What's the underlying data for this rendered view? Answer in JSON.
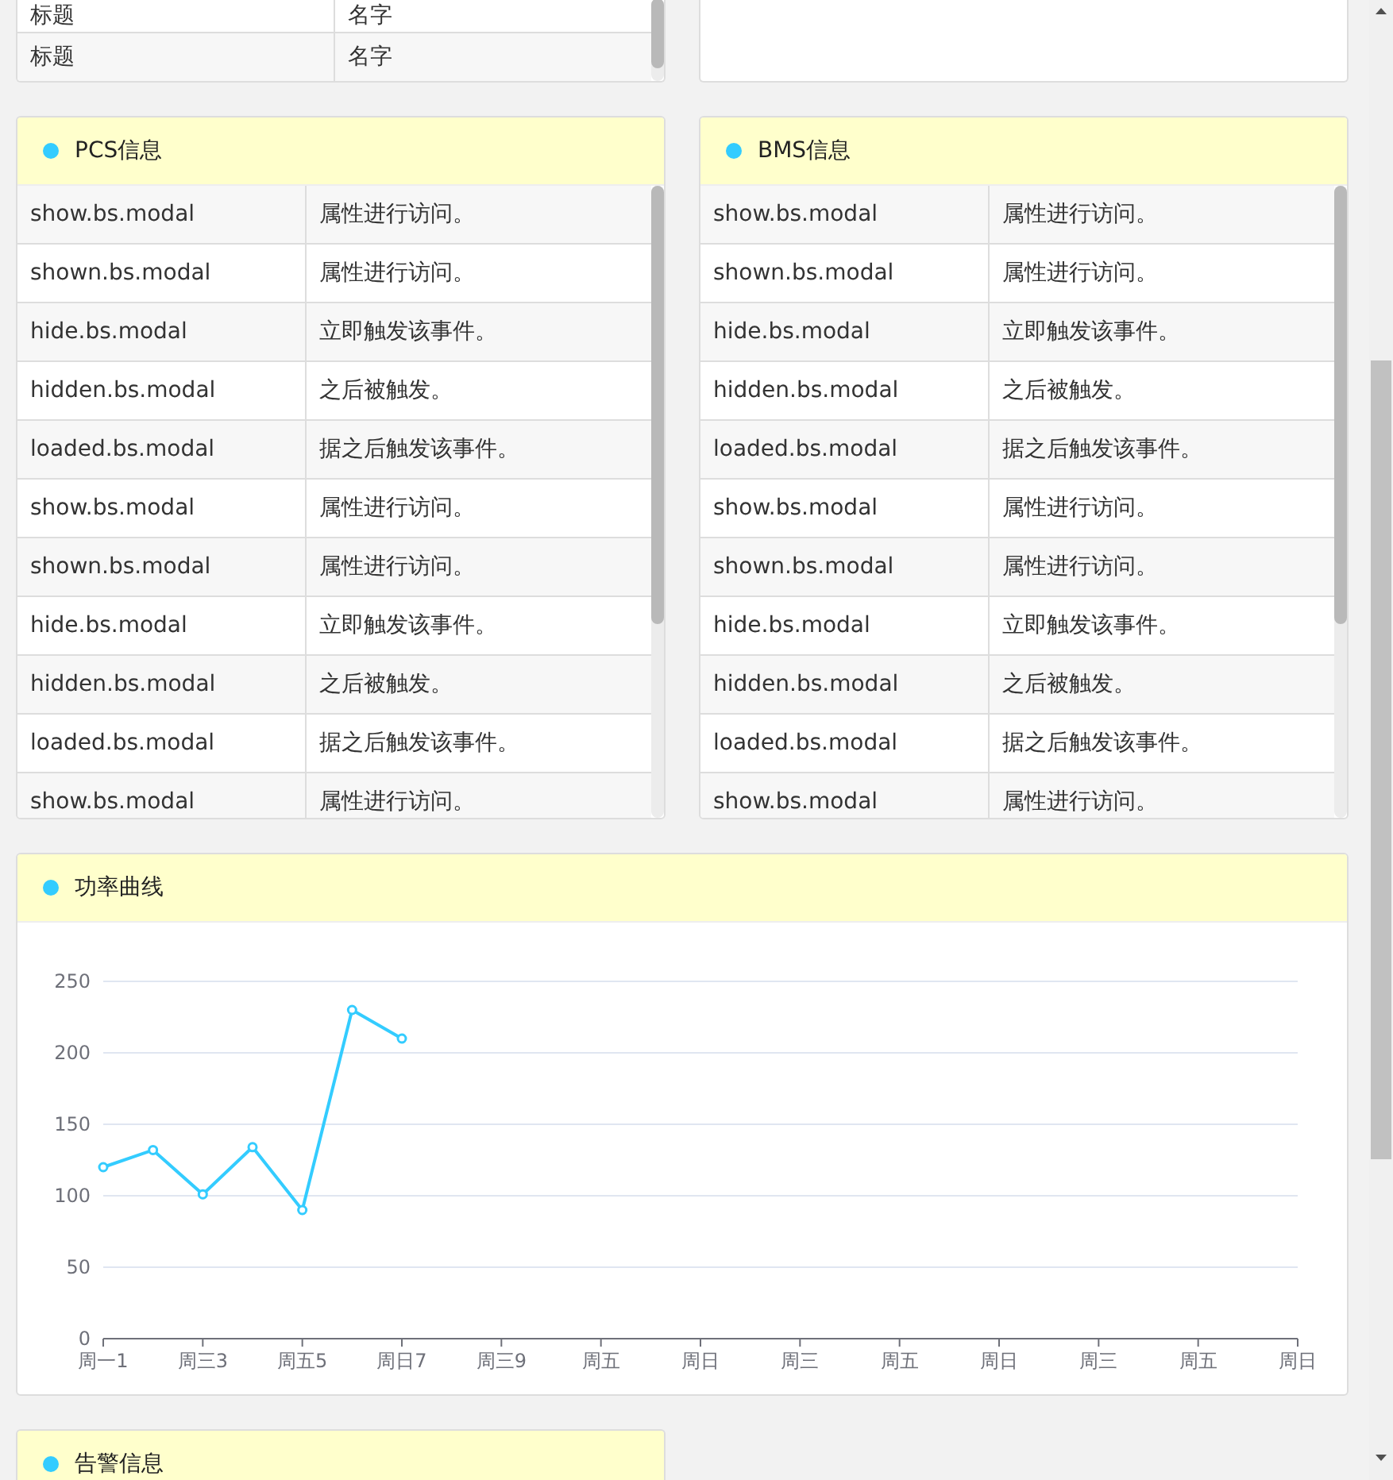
{
  "top_panels": [
    {
      "rows": [
        {
          "title": "标题",
          "name": "名字"
        },
        {
          "title": "标题",
          "name": "名字"
        }
      ]
    }
  ],
  "info_panels": [
    {
      "title": "PCS信息",
      "rows": [
        {
          "event": "show.bs.modal",
          "description": "属性进行访问。"
        },
        {
          "event": "shown.bs.modal",
          "description": "属性进行访问。"
        },
        {
          "event": "hide.bs.modal",
          "description": "立即触发该事件。"
        },
        {
          "event": "hidden.bs.modal",
          "description": "之后被触发。"
        },
        {
          "event": "loaded.bs.modal",
          "description": "据之后触发该事件。"
        },
        {
          "event": "show.bs.modal",
          "description": "属性进行访问。"
        },
        {
          "event": "shown.bs.modal",
          "description": "属性进行访问。"
        },
        {
          "event": "hide.bs.modal",
          "description": "立即触发该事件。"
        },
        {
          "event": "hidden.bs.modal",
          "description": "之后被触发。"
        },
        {
          "event": "loaded.bs.modal",
          "description": "据之后触发该事件。"
        },
        {
          "event": "show.bs.modal",
          "description": "属性进行访问。"
        }
      ]
    },
    {
      "title": "BMS信息",
      "rows": [
        {
          "event": "show.bs.modal",
          "description": "属性进行访问。"
        },
        {
          "event": "shown.bs.modal",
          "description": "属性进行访问。"
        },
        {
          "event": "hide.bs.modal",
          "description": "立即触发该事件。"
        },
        {
          "event": "hidden.bs.modal",
          "description": "之后被触发。"
        },
        {
          "event": "loaded.bs.modal",
          "description": "据之后触发该事件。"
        },
        {
          "event": "show.bs.modal",
          "description": "属性进行访问。"
        },
        {
          "event": "shown.bs.modal",
          "description": "属性进行访问。"
        },
        {
          "event": "hide.bs.modal",
          "description": "立即触发该事件。"
        },
        {
          "event": "hidden.bs.modal",
          "description": "之后被触发。"
        },
        {
          "event": "loaded.bs.modal",
          "description": "据之后触发该事件。"
        },
        {
          "event": "show.bs.modal",
          "description": "属性进行访问。"
        }
      ]
    }
  ],
  "power_panel": {
    "title": "功率曲线",
    "chart_data": {
      "type": "line",
      "categories": [
        "周一1",
        null,
        "周三3",
        null,
        "周五5",
        null,
        "周日7",
        null,
        "周三9",
        null,
        "周五",
        null,
        "周日",
        null,
        "周三",
        null,
        "周五",
        null,
        "周日",
        null,
        "周三",
        null,
        "周五",
        null,
        "周日"
      ],
      "grid": true,
      "series": [
        {
          "color": "#33ccff",
          "marker": "circle",
          "values": [
            120,
            132,
            101,
            134,
            90,
            230,
            210,
            null,
            null,
            null,
            null,
            null,
            null,
            null,
            null,
            null,
            null,
            null,
            null,
            null,
            null,
            null,
            null,
            null,
            null
          ]
        }
      ],
      "ylim": [
        0,
        250
      ],
      "yticks": [
        0,
        50,
        100,
        150,
        200,
        250
      ]
    }
  },
  "alarm_panel": {
    "title": "告警信息"
  }
}
